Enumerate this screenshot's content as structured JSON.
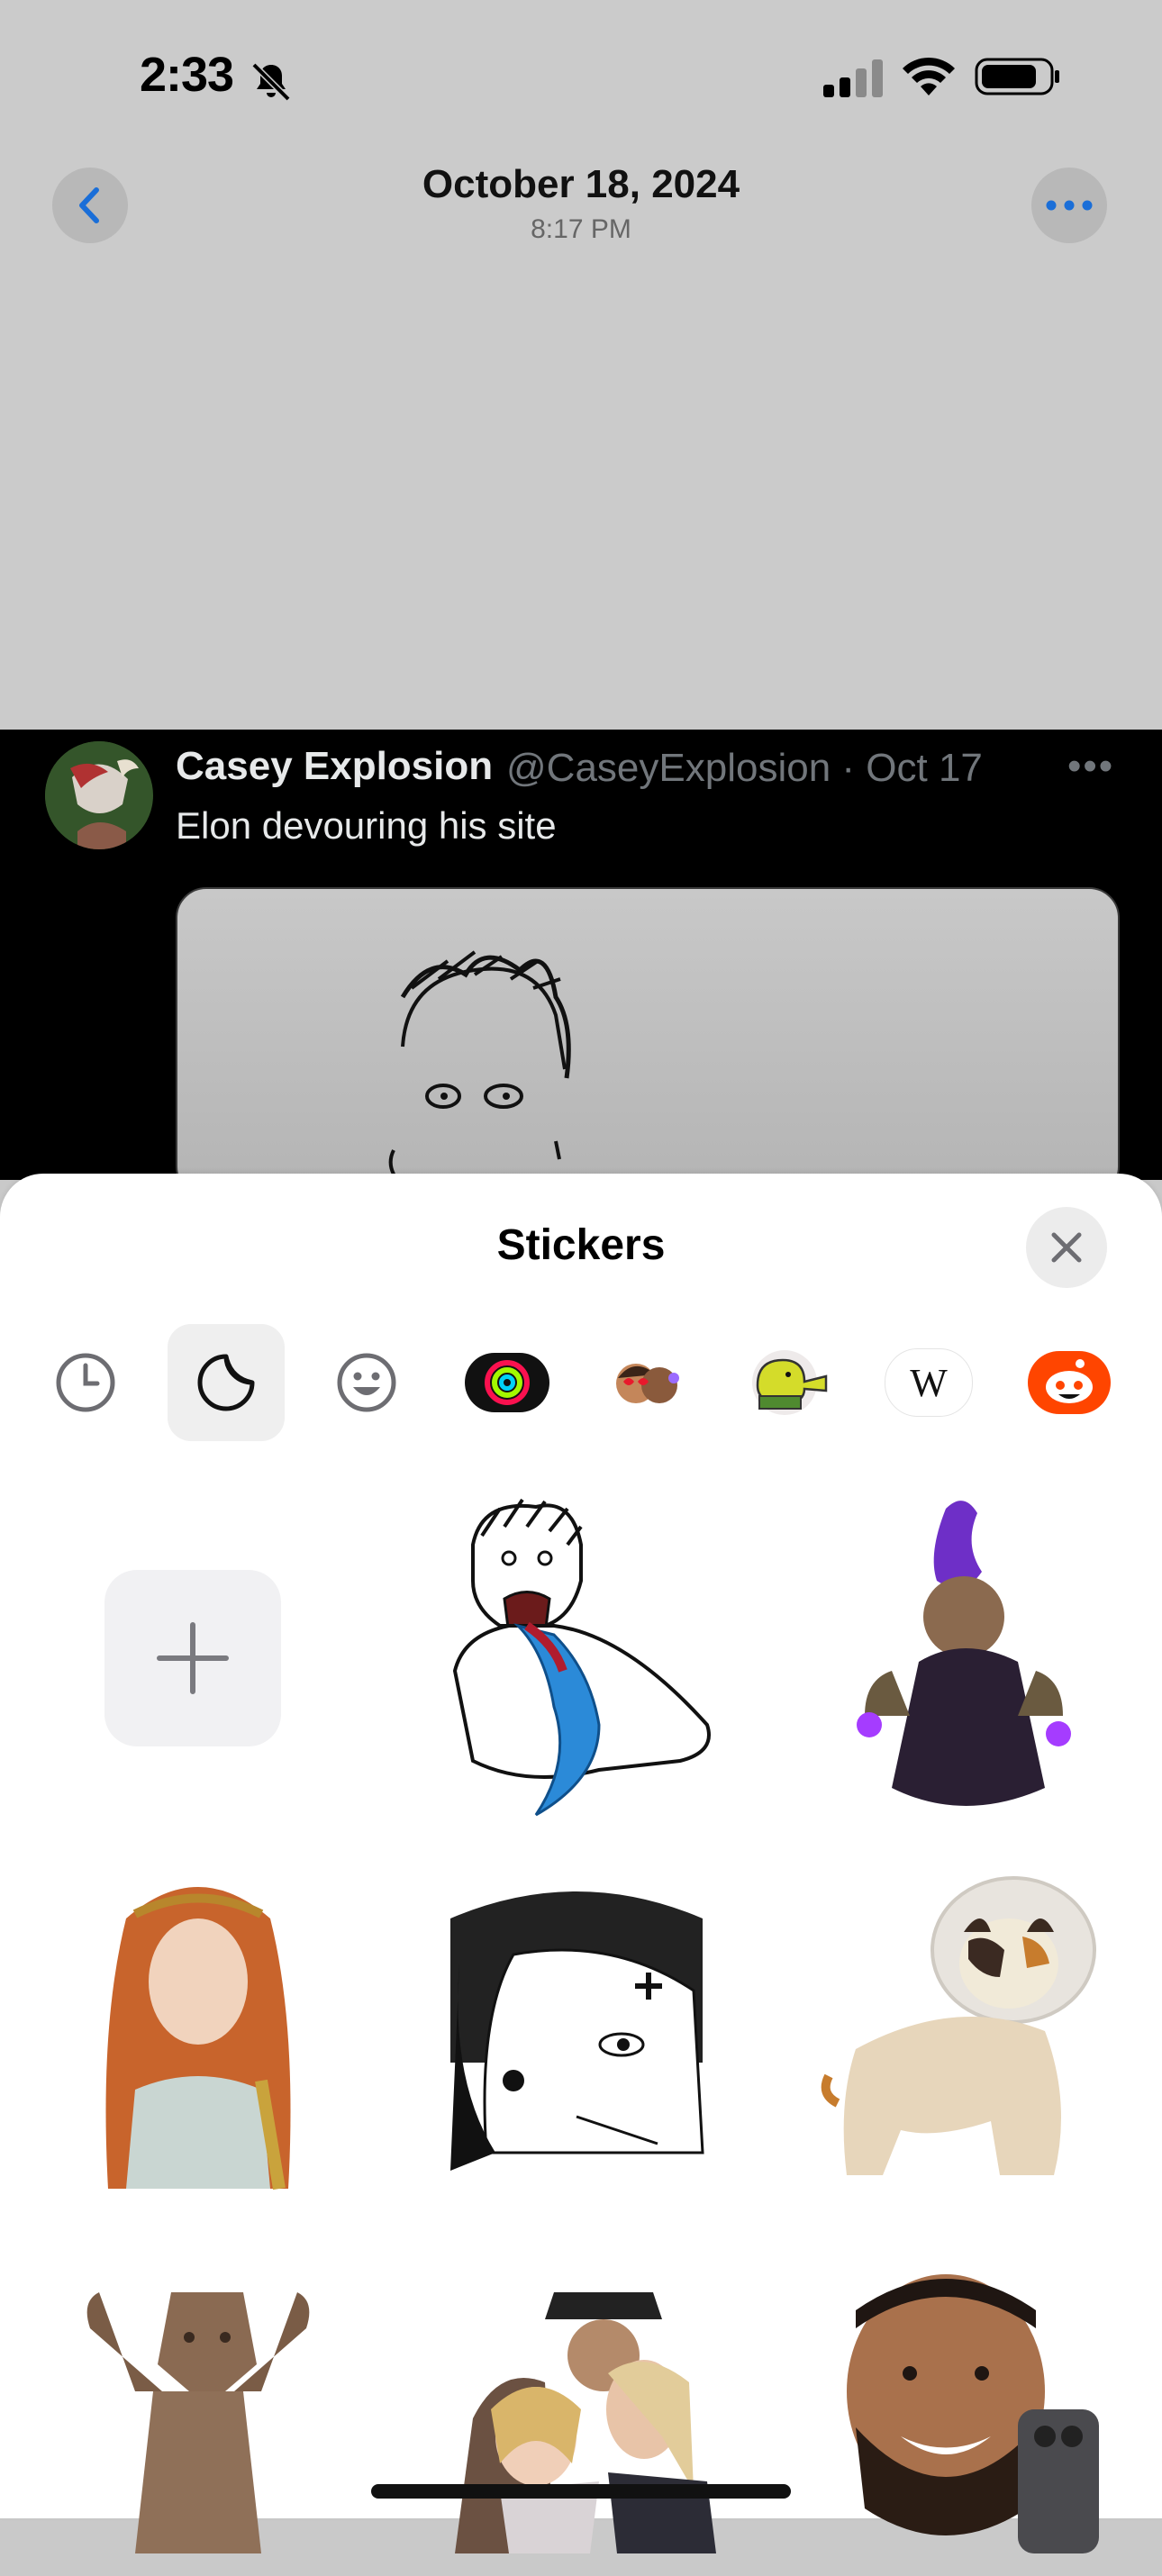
{
  "status_bar": {
    "time": "2:33"
  },
  "nav": {
    "title": "October 18, 2024",
    "subtitle": "8:17 PM"
  },
  "tweet": {
    "name": "Casey Explosion",
    "handle_date": "@CaseyExplosion · Oct 17",
    "text": "Elon devouring his site",
    "more": "•••"
  },
  "stickers_sheet": {
    "title": "Stickers",
    "tabs": [
      "recents-icon",
      "stickers-icon",
      "emoji-icon",
      "activity-rings-icon",
      "memoji-icon",
      "doodle-jump-icon",
      "wikipedia-icon",
      "reddit-icon"
    ],
    "wiki_letter": "W",
    "stickers": [
      "add-sticker",
      "elon-sketch-sticker",
      "warlock-gnome-sticker",
      "redhead-portrait-sticker",
      "manga-character-sticker",
      "cone-cat-sticker",
      "clay-figure-sticker",
      "group-photo-sticker",
      "selfie-man-sticker"
    ]
  },
  "colors": {
    "accent": "#1a6ed8",
    "sheet_bg": "#ffffff",
    "tweet_bg": "#000000"
  }
}
